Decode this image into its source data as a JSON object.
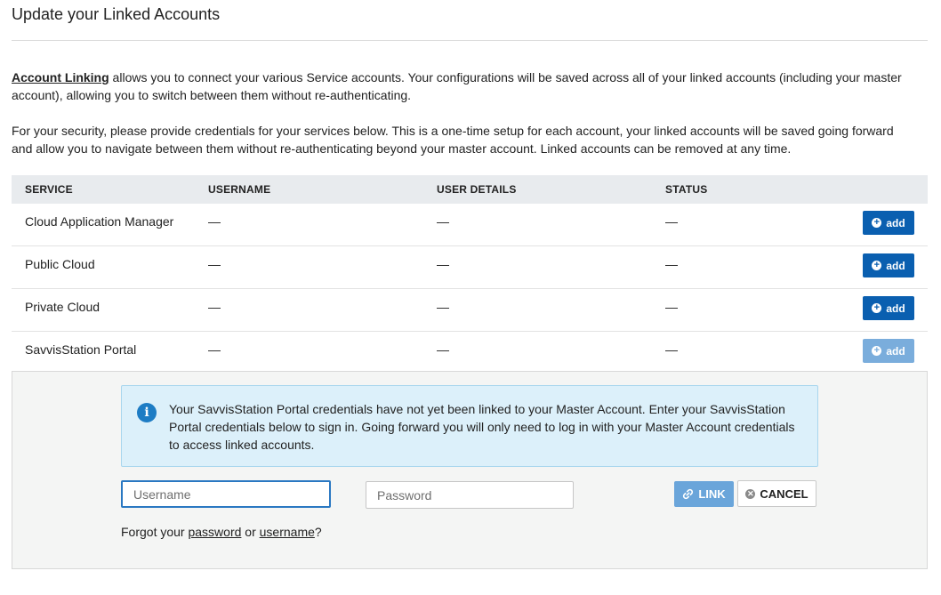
{
  "header": {
    "title": "Update your Linked Accounts"
  },
  "intro": {
    "link_term": "Account Linking",
    "text1": " allows you to connect your various Service accounts. Your configurations will be saved across all of your linked accounts (including your master account), allowing you to switch between them without re-authenticating.",
    "text2": "For your security, please provide credentials for your services below. This is a one-time setup for each account, your linked accounts will be saved going forward and allow you to navigate between them without re-authenticating beyond your master account. Linked accounts can be removed at any time."
  },
  "table": {
    "headers": [
      "SERVICE",
      "USERNAME",
      "USER DETAILS",
      "STATUS"
    ],
    "rows": [
      {
        "service": "Cloud Application Manager",
        "username": "—",
        "details": "—",
        "status": "—",
        "action": "add"
      },
      {
        "service": "Public Cloud",
        "username": "—",
        "details": "—",
        "status": "—",
        "action": "add"
      },
      {
        "service": "Private Cloud",
        "username": "—",
        "details": "—",
        "status": "—",
        "action": "add"
      },
      {
        "service": "SavvisStation Portal",
        "username": "—",
        "details": "—",
        "status": "—",
        "action": "add"
      }
    ]
  },
  "panel": {
    "info": "Your SavvisStation Portal credentials have not yet been linked to your Master Account. Enter your SavvisStation Portal credentials below to sign in. Going forward you will only need to log in with your Master Account credentials to access linked accounts.",
    "username_placeholder": "Username",
    "password_placeholder": "Password",
    "link_label": "LINK",
    "cancel_label": "CANCEL",
    "forgot_prefix": "Forgot your ",
    "forgot_password": "password",
    "forgot_or": " or ",
    "forgot_username": "username",
    "forgot_suffix": "?"
  },
  "colors": {
    "primary": "#0a5fb0",
    "primary_disabled": "#7aaddc",
    "info_bg": "#dcf0fa"
  }
}
